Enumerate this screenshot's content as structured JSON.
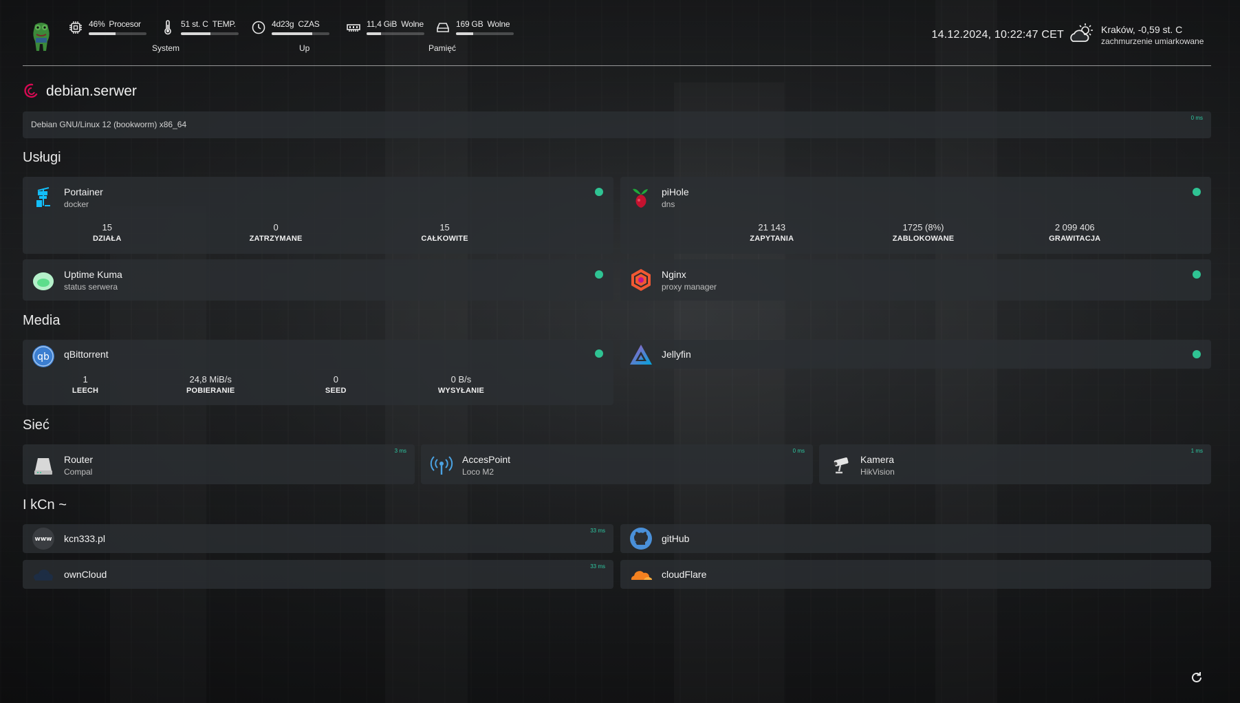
{
  "header": {
    "system": {
      "cpu": {
        "value": "46%",
        "label": "Procesor",
        "fill": 0.46,
        "icon": "cpu-icon"
      },
      "temp": {
        "value": "51 st. C",
        "label": "TEMP.",
        "fill": 0.51,
        "icon": "thermometer-icon"
      },
      "label": "System"
    },
    "uptime": {
      "value": "4d23g",
      "label": "CZAS",
      "fill": 0.7,
      "icon": "clock-icon",
      "group_label": "Up"
    },
    "memory": {
      "ram": {
        "value": "11,4 GiB",
        "label": "Wolne",
        "fill": 0.25,
        "icon": "ram-icon"
      },
      "disk": {
        "value": "169 GB",
        "label": "Wolne",
        "fill": 0.3,
        "icon": "disk-icon"
      },
      "label": "Pamięć"
    },
    "datetime": "14.12.2024, 10:22:47 CET",
    "weather": {
      "location": "Kraków, -0,59 st. C",
      "condition": "zachmurzenie umiarkowane",
      "icon": "partly-cloudy-icon"
    }
  },
  "host": {
    "name": "debian.serwer",
    "os": "Debian GNU/Linux 12 (bookworm) x86_64",
    "latency": "0 ms"
  },
  "sections": {
    "uslugi": "Usługi",
    "media": "Media",
    "siec": "Sieć",
    "kcn": "I kCn ~"
  },
  "services": {
    "portainer": {
      "name": "Portainer",
      "sub": "docker",
      "status": "online",
      "stats": [
        {
          "value": "15",
          "label": "DZIAŁA"
        },
        {
          "value": "0",
          "label": "ZATRZYMANE"
        },
        {
          "value": "15",
          "label": "CAŁKOWITE"
        }
      ]
    },
    "pihole": {
      "name": "piHole",
      "sub": "dns",
      "status": "online",
      "stats": [
        {
          "value": "21 143",
          "label": "ZAPYTANIA"
        },
        {
          "value": "1725 (8%)",
          "label": "ZABLOKOWANE"
        },
        {
          "value": "2 099 406",
          "label": "GRAWITACJA"
        }
      ]
    },
    "uptime_kuma": {
      "name": "Uptime Kuma",
      "sub": "status serwera",
      "status": "online"
    },
    "nginx": {
      "name": "Nginx",
      "sub": "proxy manager",
      "status": "online"
    }
  },
  "media": {
    "qbittorrent": {
      "name": "qBittorrent",
      "status": "online",
      "stats": [
        {
          "value": "1",
          "label": "LEECH"
        },
        {
          "value": "24,8 MiB/s",
          "label": "POBIERANIE"
        },
        {
          "value": "0",
          "label": "SEED"
        },
        {
          "value": "0 B/s",
          "label": "WYSYŁANIE"
        }
      ]
    },
    "jellyfin": {
      "name": "Jellyfin",
      "status": "online"
    }
  },
  "network": {
    "router": {
      "name": "Router",
      "sub": "Compal",
      "latency": "3 ms"
    },
    "accesspoint": {
      "name": "AccesPoint",
      "sub": "Loco M2",
      "latency": "0 ms"
    },
    "kamera": {
      "name": "Kamera",
      "sub": "HikVision",
      "latency": "1 ms"
    }
  },
  "links": {
    "kcn": {
      "name": "kcn333.pl",
      "latency": "33 ms",
      "icon_text": "www"
    },
    "github": {
      "name": "gitHub"
    },
    "owncloud": {
      "name": "ownCloud",
      "latency": "33 ms"
    },
    "cloudflare": {
      "name": "cloudFlare"
    }
  },
  "colors": {
    "status_ok": "#2fc393",
    "latency": "#2ec7a1",
    "card_bg": "#2c2f33"
  }
}
